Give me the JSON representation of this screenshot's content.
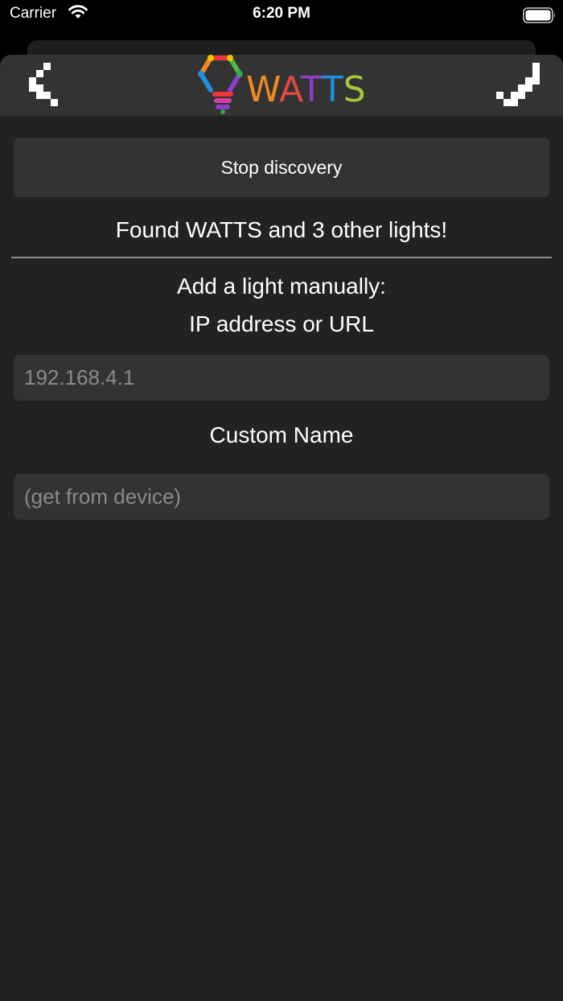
{
  "status_bar": {
    "carrier": "Carrier",
    "time": "6:20 PM",
    "wifi_icon": "wifi-icon",
    "battery_icon": "battery-icon"
  },
  "navbar": {
    "back_icon": "chevron-left-icon",
    "done_icon": "checkmark-icon",
    "logo_text": "WATTS"
  },
  "discovery": {
    "stop_label": "Stop discovery",
    "found_text": "Found WATTS and 3 other lights!"
  },
  "manual": {
    "title_line1": "Add a light manually:",
    "title_line2": "IP address or URL",
    "ip_placeholder": "192.168.4.1",
    "ip_value": "",
    "name_label": "Custom Name",
    "name_placeholder": "(get from device)",
    "name_value": ""
  },
  "colors": {
    "background": "#222222",
    "bar": "#333333",
    "text": "#ffffff",
    "placeholder": "#8a8a8a"
  }
}
